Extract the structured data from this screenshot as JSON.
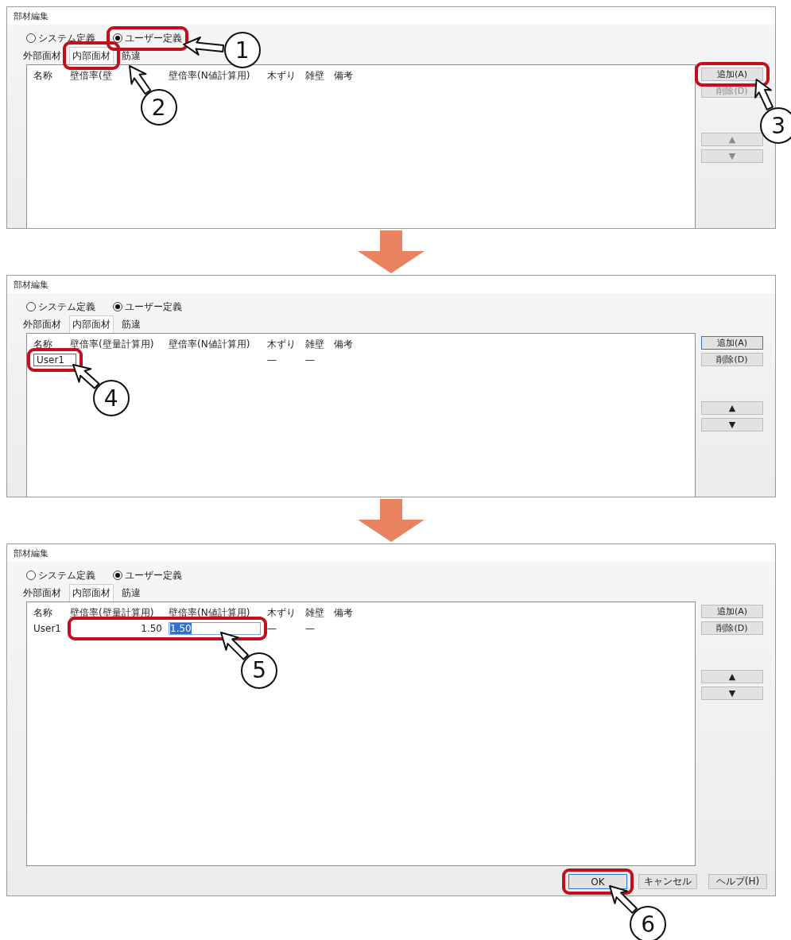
{
  "screens": [
    {
      "window_title": "部材編集",
      "radios": [
        {
          "label": "システム定義",
          "selected": false
        },
        {
          "label": "ユーザー定義",
          "selected": true
        }
      ],
      "tabs": [
        {
          "label": "外部面材",
          "selected": false
        },
        {
          "label": "内部面材",
          "selected": true
        },
        {
          "label": "筋違",
          "selected": false
        }
      ],
      "columns": [
        "名称",
        "壁倍率(壁",
        "壁倍率(N値計算用)",
        "木ずり",
        "雑壁",
        "備考"
      ],
      "side_buttons": [
        {
          "label": "追加(A)",
          "disabled": false,
          "focused": false
        },
        {
          "label": "削除(D)",
          "disabled": true,
          "focused": false
        },
        {
          "label": "▲",
          "disabled": true,
          "focused": false
        },
        {
          "label": "▼",
          "disabled": true,
          "focused": false
        }
      ],
      "callouts": [
        {
          "number": "1"
        },
        {
          "number": "2"
        },
        {
          "number": "3"
        }
      ]
    },
    {
      "window_title": "部材編集",
      "radios": [
        {
          "label": "システム定義",
          "selected": false
        },
        {
          "label": "ユーザー定義",
          "selected": true
        }
      ],
      "tabs": [
        {
          "label": "外部面材",
          "selected": false
        },
        {
          "label": "内部面材",
          "selected": true
        },
        {
          "label": "筋違",
          "selected": false
        }
      ],
      "columns": [
        "名称",
        "壁倍率(壁量計算用)",
        "壁倍率(N値計算用)",
        "木ずり",
        "雑壁",
        "備考"
      ],
      "rows": [
        {
          "kind": "editing-name",
          "name": "User1",
          "wood_lath": "—",
          "misc_wall": "—"
        }
      ],
      "side_buttons": [
        {
          "label": "追加(A)",
          "disabled": false,
          "focused": true
        },
        {
          "label": "削除(D)",
          "disabled": false,
          "focused": false
        },
        {
          "label": "▲",
          "disabled": false,
          "focused": false
        },
        {
          "label": "▼",
          "disabled": false,
          "focused": false
        }
      ],
      "callouts": [
        {
          "number": "4"
        }
      ]
    },
    {
      "window_title": "部材編集",
      "radios": [
        {
          "label": "システム定義",
          "selected": false
        },
        {
          "label": "ユーザー定義",
          "selected": true
        }
      ],
      "tabs": [
        {
          "label": "外部面材",
          "selected": false
        },
        {
          "label": "内部面材",
          "selected": true
        },
        {
          "label": "筋違",
          "selected": false
        }
      ],
      "columns": [
        "名称",
        "壁倍率(壁量計算用)",
        "壁倍率(N値計算用)",
        "木ずり",
        "雑壁",
        "備考"
      ],
      "rows": [
        {
          "kind": "editing-ratio",
          "name": "User1",
          "wall_ratio_wall": "1.50",
          "wall_ratio_n": "1.50",
          "wood_lath": "—",
          "misc_wall": "—"
        }
      ],
      "side_buttons": [
        {
          "label": "追加(A)",
          "disabled": false,
          "focused": false
        },
        {
          "label": "削除(D)",
          "disabled": false,
          "focused": false
        },
        {
          "label": "▲",
          "disabled": false,
          "focused": false
        },
        {
          "label": "▼",
          "disabled": false,
          "focused": false
        }
      ],
      "footer_buttons": [
        {
          "label": "OK",
          "focused": true
        },
        {
          "label": "キャンセル",
          "focused": false
        },
        {
          "label": "ヘルプ(H)",
          "focused": false
        }
      ],
      "callouts": [
        {
          "number": "5"
        },
        {
          "number": "6"
        }
      ]
    }
  ]
}
